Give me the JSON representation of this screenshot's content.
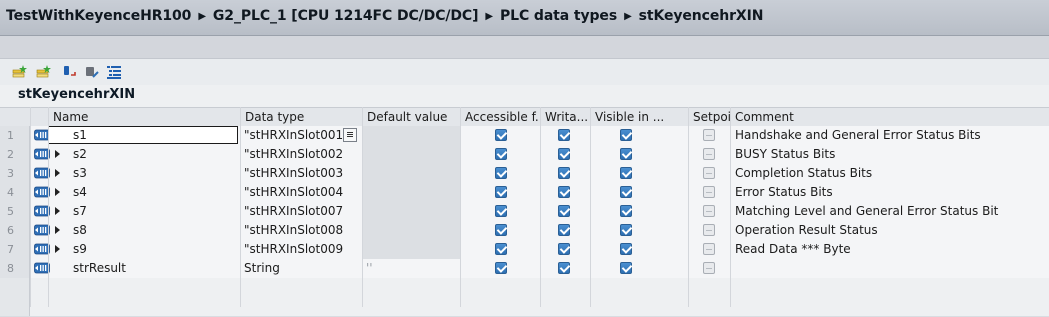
{
  "breadcrumb": {
    "items": [
      "TestWithKeyenceHR100",
      "G2_PLC_1 [CPU 1214FC DC/DC/DC]",
      "PLC data types",
      "stKeyencehrXIN"
    ]
  },
  "toolbar": {
    "icons": [
      "insert-row-icon",
      "add-row-icon",
      "expand-all-icon",
      "collapse-all-icon",
      "keep-expanded-icon"
    ]
  },
  "object_name": "stKeyencehrXIN",
  "table": {
    "columns": [
      "Name",
      "Data type",
      "Default value",
      "Accessible f...",
      "Writa...",
      "Visible in ...",
      "Setpoint",
      "Comment"
    ],
    "rows": [
      {
        "num": "1",
        "name": "s1",
        "type": "\"stHRXInSlot001\"",
        "default": "",
        "accessible": true,
        "writable": true,
        "visible": true,
        "setpoint": false,
        "comment": "Handshake and General Error Status Bits"
      },
      {
        "num": "2",
        "name": "s2",
        "type": "\"stHRXInSlot002\"",
        "default": "",
        "accessible": true,
        "writable": true,
        "visible": true,
        "setpoint": false,
        "comment": "BUSY Status Bits"
      },
      {
        "num": "3",
        "name": "s3",
        "type": "\"stHRXInSlot003\"",
        "default": "",
        "accessible": true,
        "writable": true,
        "visible": true,
        "setpoint": false,
        "comment": "Completion Status Bits"
      },
      {
        "num": "4",
        "name": "s4",
        "type": "\"stHRXInSlot004\"",
        "default": "",
        "accessible": true,
        "writable": true,
        "visible": true,
        "setpoint": false,
        "comment": "Error Status Bits"
      },
      {
        "num": "5",
        "name": "s7",
        "type": "\"stHRXInSlot007\"",
        "default": "",
        "accessible": true,
        "writable": true,
        "visible": true,
        "setpoint": false,
        "comment": "Matching Level and General Error Status Bit"
      },
      {
        "num": "6",
        "name": "s8",
        "type": "\"stHRXInSlot008\"",
        "default": "",
        "accessible": true,
        "writable": true,
        "visible": true,
        "setpoint": false,
        "comment": "Operation Result Status"
      },
      {
        "num": "7",
        "name": "s9",
        "type": "\"stHRXInSlot009\"",
        "default": "",
        "accessible": true,
        "writable": true,
        "visible": true,
        "setpoint": false,
        "comment": "Read Data *** Byte"
      },
      {
        "num": "8",
        "name": "strResult",
        "type": "String",
        "default": "''",
        "accessible": true,
        "writable": true,
        "visible": true,
        "setpoint": false,
        "comment": ""
      }
    ]
  },
  "colors": {
    "checkbox_on": "#2d6fb2",
    "title_bar": "#c9ced6",
    "default_value_column": "#dcdfe3"
  }
}
